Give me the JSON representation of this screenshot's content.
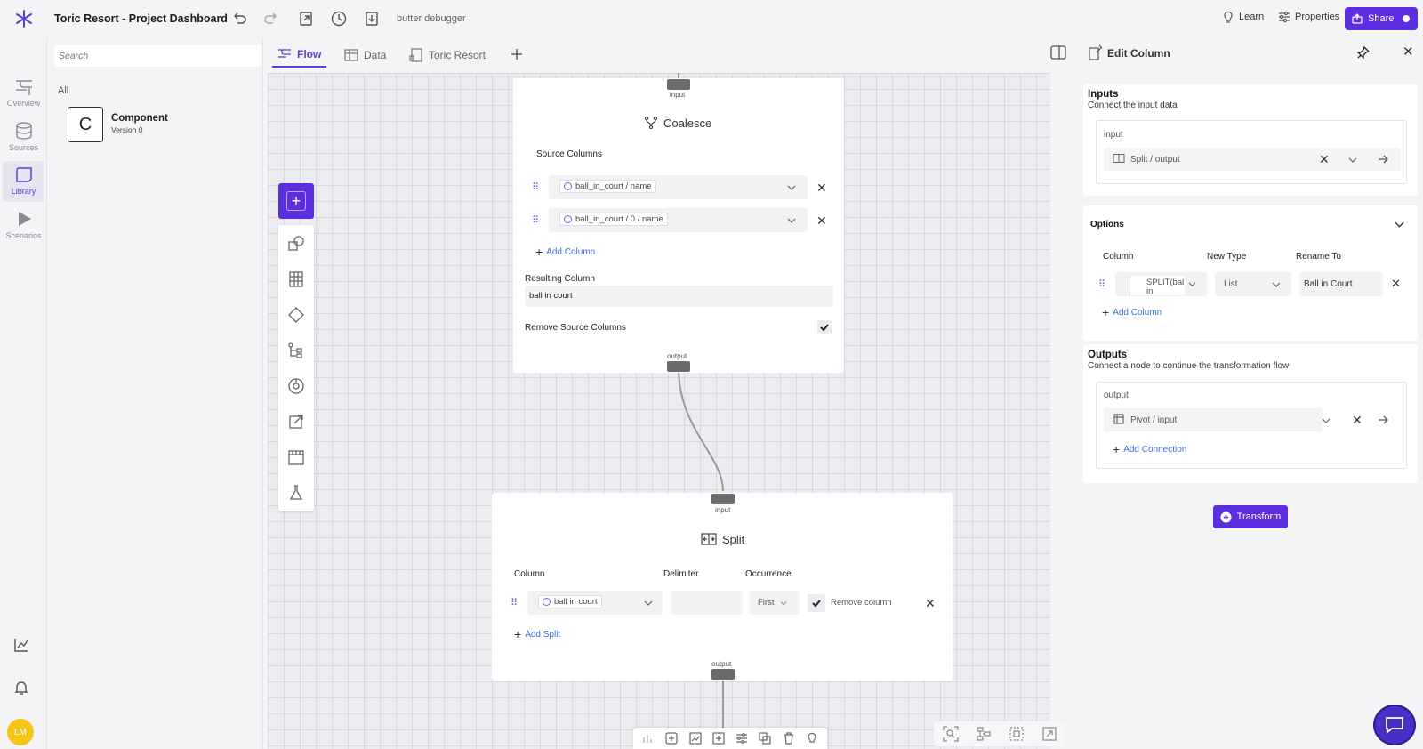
{
  "app": {
    "title": "Toric Resort - Project Dashboard",
    "debugger_label": "butter debugger",
    "learn_label": "Learn",
    "properties_label": "Properties",
    "share_label": "Share"
  },
  "rail": {
    "items": [
      {
        "label": "Overview"
      },
      {
        "label": "Sources"
      },
      {
        "label": "Library",
        "active": true
      },
      {
        "label": "Scenarios"
      }
    ],
    "avatar_initials": "LM"
  },
  "library": {
    "search_placeholder": "Search",
    "section": "All",
    "component": {
      "letter": "C",
      "name": "Component",
      "version": "Version 0"
    }
  },
  "tabs": [
    {
      "label": "Flow",
      "active": true
    },
    {
      "label": "Data"
    },
    {
      "label": "Toric Resort"
    }
  ],
  "coalesce": {
    "input_port": "input",
    "title": "Coalesce",
    "source_columns_label": "Source Columns",
    "columns": [
      "ball_in_court / name",
      "ball_in_court / 0 / name"
    ],
    "add_column": "Add Column",
    "resulting_column_label": "Resulting Column",
    "resulting_column_value": "ball in court",
    "remove_source_label": "Remove Source Columns",
    "remove_source_checked": true,
    "output_port": "output"
  },
  "split": {
    "input_port": "input",
    "title": "Split",
    "headers": {
      "column": "Column",
      "delimiter": "Delimiter",
      "occurrence": "Occurrence"
    },
    "row": {
      "column": "ball in court",
      "delimiter": "",
      "occurrence": "First",
      "remove_checked": true,
      "remove_label": "Remove column"
    },
    "add_split": "Add Split",
    "output_port": "output"
  },
  "edit_panel": {
    "title": "Edit Column",
    "inputs": {
      "title": "Inputs",
      "subtitle": "Connect the input data",
      "port_label": "input",
      "value": "Split / output"
    },
    "options": {
      "title": "Options",
      "headers": {
        "column": "Column",
        "new_type": "New Type",
        "rename_to": "Rename To"
      },
      "row": {
        "column": "SPLIT(bal in",
        "new_type": "List",
        "rename_to": "Ball in Court"
      },
      "add_column": "Add Column"
    },
    "outputs": {
      "title": "Outputs",
      "subtitle": "Connect a node to continue the transformation flow",
      "port_label": "output",
      "value": "Pivot / input",
      "add_connection": "Add Connection"
    },
    "transform_label": "Transform"
  },
  "colors": {
    "accent": "#5b2fe0",
    "link": "#3b6fd8"
  }
}
